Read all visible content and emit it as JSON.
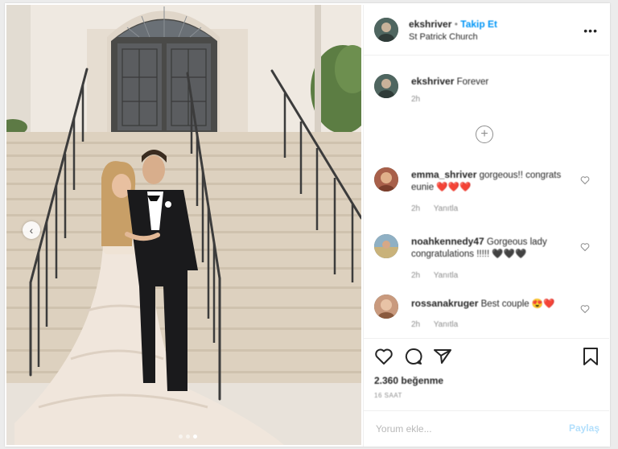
{
  "post": {
    "author": "ekshriver",
    "separator": "•",
    "follow_label": "Takip Et",
    "location": "St Patrick Church",
    "more_label": "•••"
  },
  "caption": {
    "username": "ekshriver",
    "text": "Forever",
    "time": "2h"
  },
  "comments": [
    {
      "username": "emma_shriver",
      "text": "gorgeous!! congrats eunie ❤️❤️❤️",
      "time": "2h",
      "reply_label": "Yanıtla"
    },
    {
      "username": "noahkennedy47",
      "text": "Gorgeous lady congratulations !!!!! 🖤🖤🖤",
      "time": "2h",
      "reply_label": "Yanıtla"
    },
    {
      "username": "rossanakruger",
      "text": "Best couple 😍❤️",
      "time": "2h",
      "reply_label": "Yanıtla"
    }
  ],
  "actions": {
    "like_icon": "heart-icon",
    "comment_icon": "comment-icon",
    "share_icon": "share-icon",
    "save_icon": "bookmark-icon"
  },
  "likes_text": "2.360 beğenme",
  "date_text": "16 SAAT",
  "comment_input": {
    "placeholder": "Yorum ekle...",
    "post_label": "Paylaş"
  },
  "carousel": {
    "prev_label": "‹"
  },
  "colors": {
    "accent": "#0095f6",
    "post_disabled": "#b2dffc",
    "text": "#262626",
    "muted": "#8e8e8e"
  }
}
